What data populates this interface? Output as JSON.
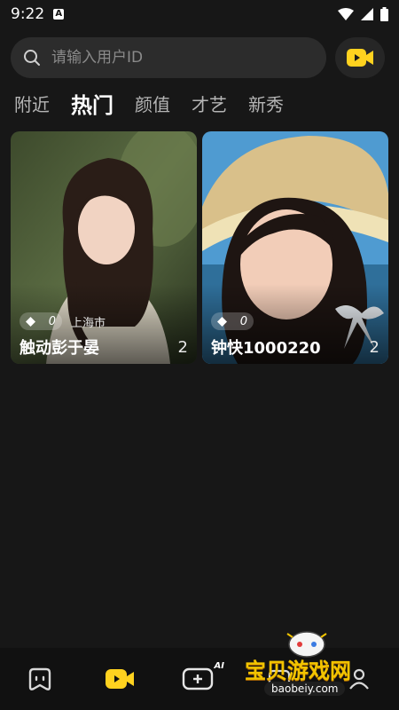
{
  "status": {
    "time": "9:22",
    "a_badge": "A"
  },
  "search": {
    "placeholder": "请输入用户ID",
    "value": ""
  },
  "tabs": [
    {
      "label": "附近",
      "active": false
    },
    {
      "label": "热门",
      "active": true
    },
    {
      "label": "颜值",
      "active": false
    },
    {
      "label": "才艺",
      "active": false
    },
    {
      "label": "新秀",
      "active": false
    }
  ],
  "cards": [
    {
      "pill_value": "0",
      "location": "上海市",
      "name": "触动彭于晏",
      "count": "2"
    },
    {
      "pill_value": "0",
      "location": "",
      "name": "钟快1000220",
      "count": "2"
    }
  ],
  "bottom_nav": {
    "home_icon": "robot-face-icon",
    "video_icon": "video-camera-icon",
    "ai_label": "AI",
    "profile_icon": "user-icon"
  },
  "watermark": {
    "title": "宝贝游戏网",
    "url": "baobeiy.com"
  },
  "colors": {
    "accent": "#ffd21f",
    "background": "#171717"
  }
}
